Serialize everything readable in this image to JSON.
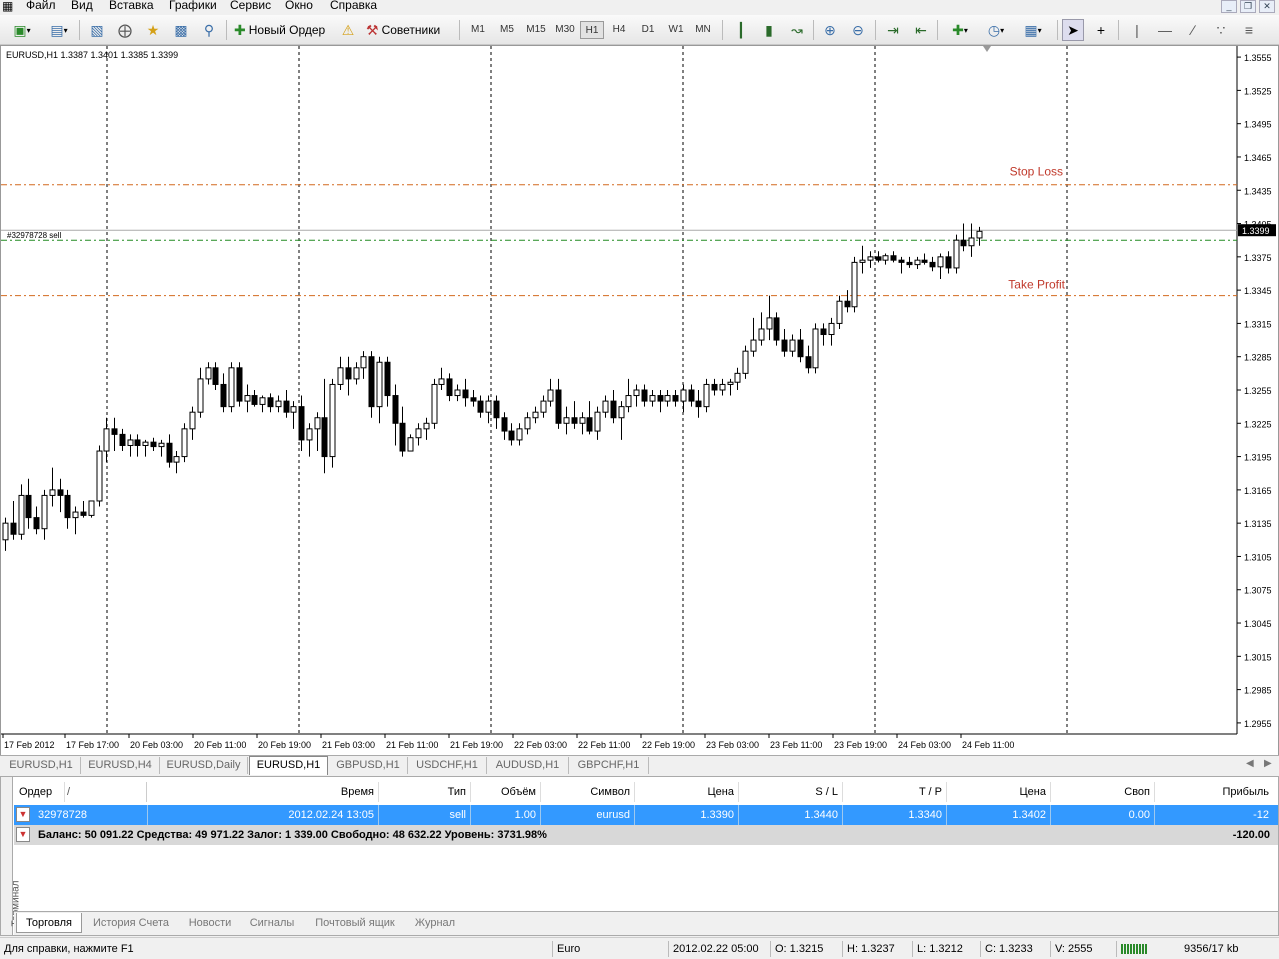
{
  "menu": {
    "items": [
      "Файл",
      "Вид",
      "Вставка",
      "Графики",
      "Сервис",
      "Окно",
      "Справка"
    ],
    "window_controls": [
      "_",
      "❐",
      "✕"
    ]
  },
  "toolbar": {
    "new_order_label": "Новый Ордер",
    "experts_label": "Советники",
    "timeframes": [
      "M1",
      "M5",
      "M15",
      "M30",
      "H1",
      "H4",
      "D1",
      "W1",
      "MN"
    ],
    "active_timeframe": "H1"
  },
  "chart": {
    "symbol_info": "EURUSD,H1  1.3387 1.3401 1.3385 1.3399",
    "order_label": "#32978728 sell",
    "stop_loss_label": "Stop Loss",
    "take_profit_label": "Take Profit",
    "current_price_label": "1.3399",
    "up_color": "#ffffff",
    "down_color": "#000000",
    "sl_tp_color": "#d2691e",
    "order_color": "#228b22"
  },
  "chart_data": {
    "type": "candlestick",
    "symbol": "EURUSD",
    "timeframe": "H1",
    "ylim": [
      1.2945,
      1.3565
    ],
    "y_ticks": [
      "1.3555",
      "1.3525",
      "1.3495",
      "1.3465",
      "1.3435",
      "1.3405",
      "1.3375",
      "1.3345",
      "1.3315",
      "1.3285",
      "1.3255",
      "1.3225",
      "1.3195",
      "1.3165",
      "1.3135",
      "1.3105",
      "1.3075",
      "1.3045",
      "1.3015",
      "1.2985",
      "1.2955"
    ],
    "x_ticks": [
      "17 Feb 2012",
      "17 Feb 17:00",
      "20 Feb 03:00",
      "20 Feb 11:00",
      "20 Feb 19:00",
      "21 Feb 03:00",
      "21 Feb 11:00",
      "21 Feb 19:00",
      "22 Feb 03:00",
      "22 Feb 11:00",
      "22 Feb 19:00",
      "23 Feb 03:00",
      "23 Feb 11:00",
      "23 Feb 19:00",
      "24 Feb 03:00",
      "24 Feb 11:00"
    ],
    "stop_loss": 1.344,
    "take_profit": 1.334,
    "order_open": 1.339,
    "bid": 1.3399,
    "candles": [
      [
        1.312,
        1.314,
        1.311,
        1.3135
      ],
      [
        1.3135,
        1.3155,
        1.312,
        1.3125
      ],
      [
        1.3125,
        1.317,
        1.312,
        1.316
      ],
      [
        1.316,
        1.3175,
        1.313,
        1.314
      ],
      [
        1.314,
        1.315,
        1.3125,
        1.313
      ],
      [
        1.313,
        1.3165,
        1.312,
        1.316
      ],
      [
        1.316,
        1.3185,
        1.315,
        1.3165
      ],
      [
        1.3165,
        1.3175,
        1.3145,
        1.316
      ],
      [
        1.316,
        1.3165,
        1.313,
        1.314
      ],
      [
        1.314,
        1.315,
        1.3125,
        1.3145
      ],
      [
        1.3145,
        1.3155,
        1.314,
        1.3142
      ],
      [
        1.3142,
        1.3155,
        1.314,
        1.3155
      ],
      [
        1.3155,
        1.3205,
        1.315,
        1.32
      ],
      [
        1.32,
        1.323,
        1.319,
        1.322
      ],
      [
        1.322,
        1.323,
        1.32,
        1.3215
      ],
      [
        1.3215,
        1.322,
        1.32,
        1.3205
      ],
      [
        1.3205,
        1.3215,
        1.3195,
        1.321
      ],
      [
        1.321,
        1.3215,
        1.3195,
        1.3205
      ],
      [
        1.3205,
        1.321,
        1.3195,
        1.3208
      ],
      [
        1.3208,
        1.3212,
        1.32,
        1.3204
      ],
      [
        1.3204,
        1.321,
        1.3195,
        1.3207
      ],
      [
        1.3207,
        1.3215,
        1.3185,
        1.319
      ],
      [
        1.319,
        1.32,
        1.318,
        1.3195
      ],
      [
        1.3195,
        1.3225,
        1.319,
        1.322
      ],
      [
        1.322,
        1.324,
        1.321,
        1.3235
      ],
      [
        1.3235,
        1.3275,
        1.323,
        1.3265
      ],
      [
        1.3265,
        1.328,
        1.326,
        1.3275
      ],
      [
        1.3275,
        1.328,
        1.3255,
        1.326
      ],
      [
        1.326,
        1.327,
        1.3235,
        1.324
      ],
      [
        1.324,
        1.328,
        1.3235,
        1.3275
      ],
      [
        1.3275,
        1.328,
        1.324,
        1.3245
      ],
      [
        1.3245,
        1.326,
        1.3235,
        1.325
      ],
      [
        1.325,
        1.3255,
        1.324,
        1.3242
      ],
      [
        1.3242,
        1.325,
        1.3235,
        1.3248
      ],
      [
        1.3248,
        1.3252,
        1.3235,
        1.324
      ],
      [
        1.324,
        1.325,
        1.3235,
        1.3245
      ],
      [
        1.3245,
        1.3255,
        1.323,
        1.3235
      ],
      [
        1.3235,
        1.3245,
        1.322,
        1.324
      ],
      [
        1.324,
        1.325,
        1.32,
        1.321
      ],
      [
        1.321,
        1.3225,
        1.3195,
        1.322
      ],
      [
        1.322,
        1.3235,
        1.32,
        1.323
      ],
      [
        1.323,
        1.3265,
        1.318,
        1.3195
      ],
      [
        1.3195,
        1.3265,
        1.3185,
        1.326
      ],
      [
        1.326,
        1.3285,
        1.3255,
        1.3275
      ],
      [
        1.3275,
        1.3285,
        1.325,
        1.3265
      ],
      [
        1.3265,
        1.328,
        1.326,
        1.3275
      ],
      [
        1.3275,
        1.329,
        1.3265,
        1.3285
      ],
      [
        1.3285,
        1.329,
        1.323,
        1.324
      ],
      [
        1.324,
        1.3285,
        1.3225,
        1.328
      ],
      [
        1.328,
        1.3285,
        1.324,
        1.325
      ],
      [
        1.325,
        1.326,
        1.3205,
        1.3225
      ],
      [
        1.3225,
        1.324,
        1.3195,
        1.32
      ],
      [
        1.32,
        1.3215,
        1.32,
        1.3212
      ],
      [
        1.3212,
        1.3225,
        1.3205,
        1.322
      ],
      [
        1.322,
        1.323,
        1.321,
        1.3225
      ],
      [
        1.3225,
        1.3265,
        1.322,
        1.326
      ],
      [
        1.326,
        1.3275,
        1.3255,
        1.3265
      ],
      [
        1.3265,
        1.327,
        1.3245,
        1.325
      ],
      [
        1.325,
        1.326,
        1.3245,
        1.3255
      ],
      [
        1.3255,
        1.3265,
        1.324,
        1.3248
      ],
      [
        1.3248,
        1.3255,
        1.324,
        1.3245
      ],
      [
        1.3245,
        1.325,
        1.323,
        1.3235
      ],
      [
        1.3235,
        1.325,
        1.3225,
        1.3245
      ],
      [
        1.3245,
        1.325,
        1.322,
        1.323
      ],
      [
        1.323,
        1.3235,
        1.321,
        1.3218
      ],
      [
        1.3218,
        1.3225,
        1.3205,
        1.321
      ],
      [
        1.321,
        1.3225,
        1.3205,
        1.322
      ],
      [
        1.322,
        1.3235,
        1.3215,
        1.323
      ],
      [
        1.323,
        1.324,
        1.3225,
        1.3235
      ],
      [
        1.3235,
        1.325,
        1.323,
        1.3245
      ],
      [
        1.3245,
        1.3265,
        1.324,
        1.3255
      ],
      [
        1.3255,
        1.3265,
        1.322,
        1.3225
      ],
      [
        1.3225,
        1.324,
        1.3215,
        1.323
      ],
      [
        1.323,
        1.3245,
        1.322,
        1.3225
      ],
      [
        1.3225,
        1.3235,
        1.3215,
        1.323
      ],
      [
        1.323,
        1.3245,
        1.3215,
        1.3218
      ],
      [
        1.3218,
        1.324,
        1.321,
        1.3235
      ],
      [
        1.3235,
        1.325,
        1.323,
        1.3245
      ],
      [
        1.3245,
        1.3255,
        1.3225,
        1.323
      ],
      [
        1.323,
        1.3245,
        1.321,
        1.324
      ],
      [
        1.324,
        1.3265,
        1.3235,
        1.325
      ],
      [
        1.325,
        1.326,
        1.324,
        1.3255
      ],
      [
        1.3255,
        1.326,
        1.324,
        1.3245
      ],
      [
        1.3245,
        1.3255,
        1.324,
        1.325
      ],
      [
        1.325,
        1.3255,
        1.3235,
        1.3245
      ],
      [
        1.3245,
        1.3255,
        1.324,
        1.325
      ],
      [
        1.325,
        1.3255,
        1.324,
        1.3245
      ],
      [
        1.3245,
        1.326,
        1.3235,
        1.3255
      ],
      [
        1.3255,
        1.326,
        1.324,
        1.3245
      ],
      [
        1.3245,
        1.3255,
        1.323,
        1.324
      ],
      [
        1.324,
        1.3265,
        1.3235,
        1.326
      ],
      [
        1.326,
        1.3265,
        1.325,
        1.3255
      ],
      [
        1.3255,
        1.3265,
        1.325,
        1.326
      ],
      [
        1.326,
        1.3265,
        1.325,
        1.3262
      ],
      [
        1.3262,
        1.3275,
        1.3255,
        1.327
      ],
      [
        1.327,
        1.3295,
        1.3265,
        1.329
      ],
      [
        1.329,
        1.332,
        1.3285,
        1.33
      ],
      [
        1.33,
        1.3325,
        1.3295,
        1.331
      ],
      [
        1.331,
        1.334,
        1.33,
        1.332
      ],
      [
        1.332,
        1.3325,
        1.3295,
        1.33
      ],
      [
        1.33,
        1.331,
        1.3285,
        1.329
      ],
      [
        1.329,
        1.3305,
        1.3285,
        1.33
      ],
      [
        1.33,
        1.331,
        1.328,
        1.3285
      ],
      [
        1.3285,
        1.3295,
        1.327,
        1.3275
      ],
      [
        1.3275,
        1.3315,
        1.327,
        1.331
      ],
      [
        1.331,
        1.3315,
        1.3295,
        1.3305
      ],
      [
        1.3305,
        1.332,
        1.3295,
        1.3315
      ],
      [
        1.3315,
        1.334,
        1.331,
        1.3335
      ],
      [
        1.3335,
        1.3345,
        1.3325,
        1.333
      ],
      [
        1.333,
        1.3375,
        1.3325,
        1.337
      ],
      [
        1.337,
        1.3385,
        1.336,
        1.3372
      ],
      [
        1.3372,
        1.338,
        1.3365,
        1.3375
      ],
      [
        1.3375,
        1.338,
        1.337,
        1.3372
      ],
      [
        1.3372,
        1.3378,
        1.3368,
        1.3376
      ],
      [
        1.3376,
        1.338,
        1.337,
        1.3372
      ],
      [
        1.3372,
        1.3375,
        1.336,
        1.337
      ],
      [
        1.337,
        1.3375,
        1.3365,
        1.3368
      ],
      [
        1.3368,
        1.3375,
        1.3364,
        1.3372
      ],
      [
        1.3372,
        1.3378,
        1.3368,
        1.337
      ],
      [
        1.337,
        1.3375,
        1.3362,
        1.3366
      ],
      [
        1.3366,
        1.3378,
        1.3355,
        1.3375
      ],
      [
        1.3375,
        1.338,
        1.336,
        1.3365
      ],
      [
        1.3365,
        1.3395,
        1.336,
        1.339
      ],
      [
        1.339,
        1.3405,
        1.338,
        1.3385
      ],
      [
        1.3385,
        1.3405,
        1.3375,
        1.3392
      ],
      [
        1.3392,
        1.3402,
        1.3385,
        1.3398
      ]
    ]
  },
  "chart_tabs": [
    "EURUSD,H1",
    "EURUSD,H4",
    "EURUSD,Daily",
    "EURUSD,H1",
    "GBPUSD,H1",
    "USDCHF,H1",
    "AUDUSD,H1",
    "GBPCHF,H1"
  ],
  "chart_tabs_active": 3,
  "terminal": {
    "side_label": "Терминал",
    "columns": [
      "Ордер",
      "/",
      "Время",
      "Тип",
      "Объём",
      "Символ",
      "Цена",
      "S / L",
      "T / P",
      "Цена",
      "Своп",
      "Прибыль"
    ],
    "order_row": [
      "32978728",
      "2012.02.24 13:05",
      "sell",
      "1.00",
      "eurusd",
      "1.3390",
      "1.3440",
      "1.3340",
      "1.3402",
      "0.00",
      "-12"
    ],
    "balance_text": "Баланс: 50 091.22  Средства: 49 971.22  Залог: 1 339.00  Свободно: 48 632.22  Уровень: 3731.98%",
    "balance_profit": "-120.00",
    "tabs": [
      "Торговля",
      "История Счета",
      "Новости",
      "Сигналы",
      "Почтовый ящик",
      "Журнал"
    ],
    "active_tab": 0
  },
  "status": {
    "help": "Для справки, нажмите F1",
    "profile": "Euro",
    "datetime": "2012.02.22 05:00",
    "open": "O: 1.3215",
    "high": "H: 1.3237",
    "low": "L: 1.3212",
    "close": "C: 1.3233",
    "volume": "V: 2555",
    "traffic": "9356/17 kb"
  }
}
